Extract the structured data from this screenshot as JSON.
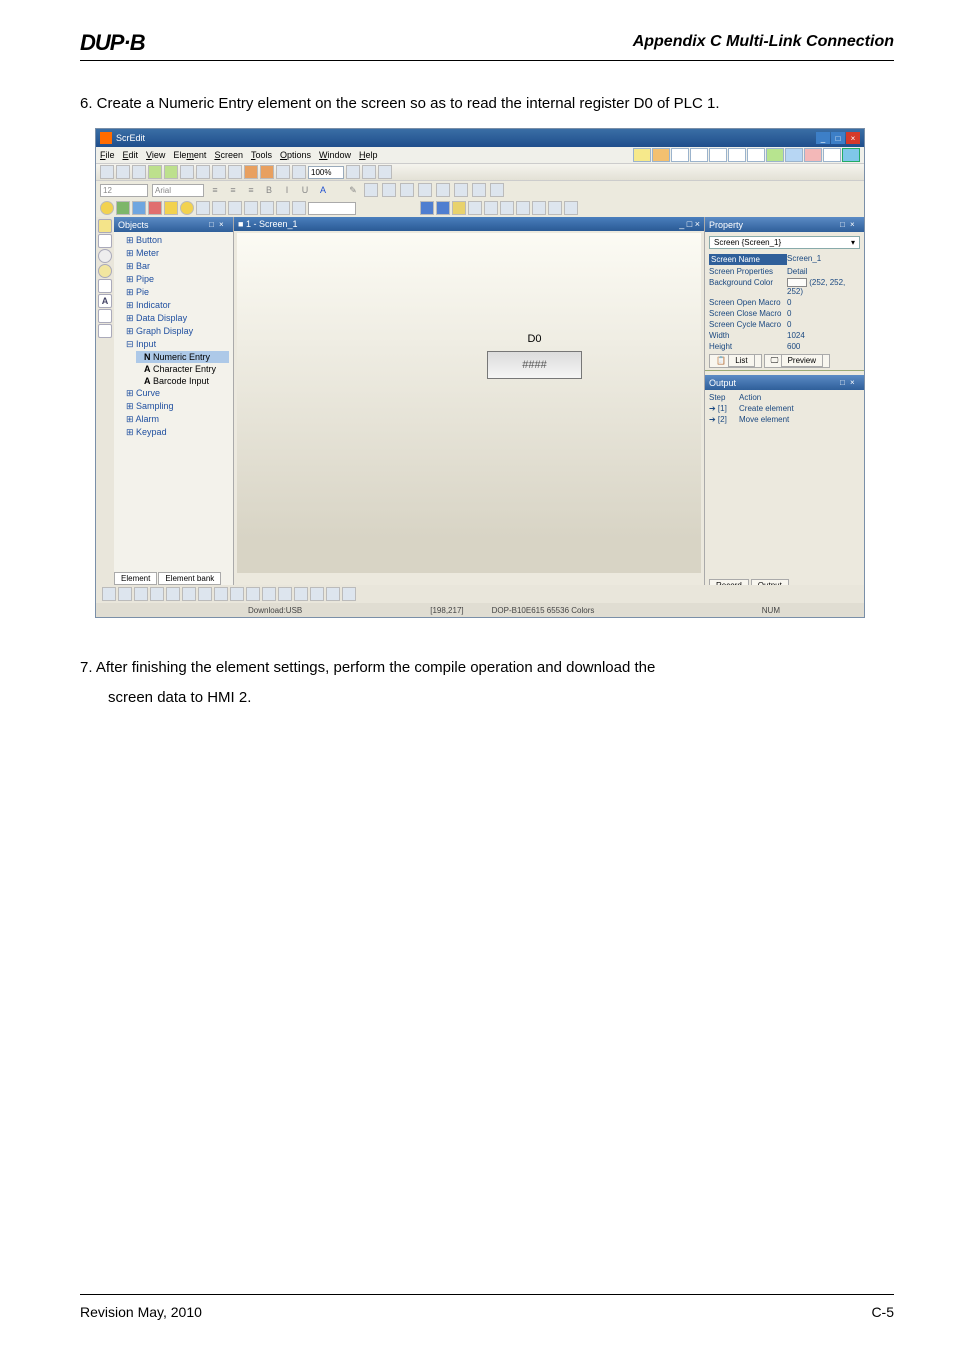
{
  "page": {
    "logo": "DUP·B",
    "appendix": "Appendix C Multi-Link Connection",
    "step6": "6.  Create a Numeric Entry element on the screen so as to read the internal register D0 of PLC 1.",
    "step7_line1": "7.  After finishing the element settings, perform the compile operation and download the",
    "step7_line2": "screen data to HMI 2.",
    "footer_left": "Revision May, 2010",
    "footer_right": "C-5"
  },
  "app": {
    "title": "ScrEdit",
    "menus": [
      "File",
      "Edit",
      "View",
      "Element",
      "Screen",
      "Tools",
      "Options",
      "Window",
      "Help"
    ],
    "zoom": "100%",
    "font_size": "12",
    "font_name": "Arial"
  },
  "objects": {
    "title": "Objects",
    "items": [
      "Button",
      "Meter",
      "Bar",
      "Pipe",
      "Pie",
      "Indicator",
      "Data Display",
      "Graph Display",
      "Input"
    ],
    "input_children": [
      "Numeric Entry",
      "Character Entry",
      "Barcode Input"
    ],
    "items2": [
      "Curve",
      "Sampling",
      "Alarm",
      "Keypad"
    ],
    "bottom_tabs": [
      "Element",
      "Element bank"
    ]
  },
  "canvas": {
    "title": "1 - Screen_1",
    "element_label": "D0",
    "numeric_placeholder": "####"
  },
  "property": {
    "title": "Property",
    "screen_select": "Screen {Screen_1}",
    "rows": [
      {
        "k": "Screen Name",
        "v": "Screen_1",
        "sel": true
      },
      {
        "k": "Screen Properties",
        "v": "Detail"
      },
      {
        "k": "Background Color",
        "v": "(252, 252, 252)",
        "swatch": true
      },
      {
        "k": "Screen Open Macro",
        "v": "0"
      },
      {
        "k": "Screen Close Macro",
        "v": "0"
      },
      {
        "k": "Screen Cycle Macro",
        "v": "0"
      },
      {
        "k": "Width",
        "v": "1024"
      },
      {
        "k": "Height",
        "v": "600"
      }
    ],
    "tabs": [
      "List",
      "Preview"
    ]
  },
  "output": {
    "title": "Output",
    "header": {
      "k": "Step",
      "v": "Action"
    },
    "rows": [
      {
        "k": "➔ [1]",
        "v": "Create element"
      },
      {
        "k": "➔ [2]",
        "v": "Move element"
      }
    ],
    "tabs": [
      "Record",
      "Output"
    ]
  },
  "status": {
    "download": "Download:USB",
    "coords": "[198,217]",
    "device": "DOP-B10E615 65536 Colors",
    "num": "NUM"
  }
}
